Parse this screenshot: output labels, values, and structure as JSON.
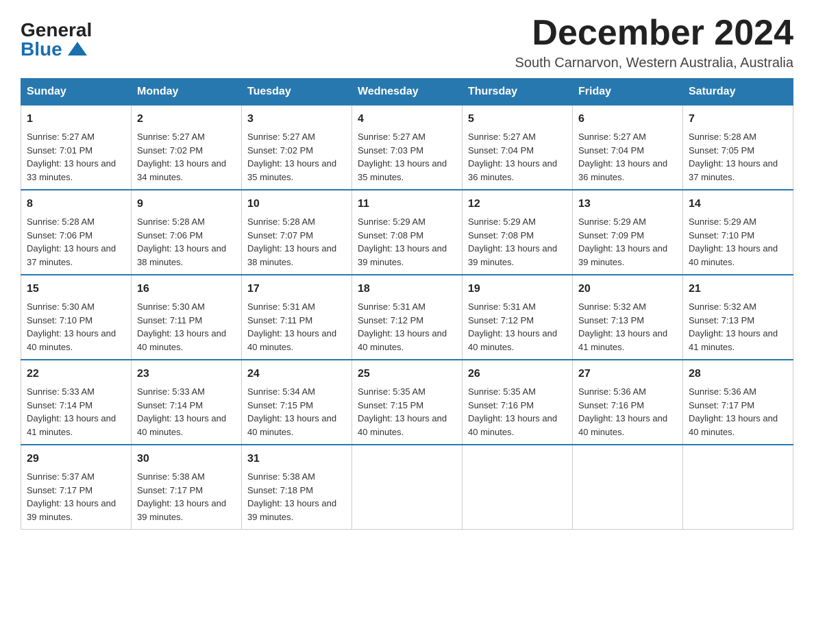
{
  "header": {
    "logo_general": "General",
    "logo_blue": "Blue",
    "month_title": "December 2024",
    "subtitle": "South Carnarvon, Western Australia, Australia"
  },
  "days_of_week": [
    "Sunday",
    "Monday",
    "Tuesday",
    "Wednesday",
    "Thursday",
    "Friday",
    "Saturday"
  ],
  "weeks": [
    [
      {
        "day": "1",
        "sunrise": "5:27 AM",
        "sunset": "7:01 PM",
        "daylight": "13 hours and 33 minutes."
      },
      {
        "day": "2",
        "sunrise": "5:27 AM",
        "sunset": "7:02 PM",
        "daylight": "13 hours and 34 minutes."
      },
      {
        "day": "3",
        "sunrise": "5:27 AM",
        "sunset": "7:02 PM",
        "daylight": "13 hours and 35 minutes."
      },
      {
        "day": "4",
        "sunrise": "5:27 AM",
        "sunset": "7:03 PM",
        "daylight": "13 hours and 35 minutes."
      },
      {
        "day": "5",
        "sunrise": "5:27 AM",
        "sunset": "7:04 PM",
        "daylight": "13 hours and 36 minutes."
      },
      {
        "day": "6",
        "sunrise": "5:27 AM",
        "sunset": "7:04 PM",
        "daylight": "13 hours and 36 minutes."
      },
      {
        "day": "7",
        "sunrise": "5:28 AM",
        "sunset": "7:05 PM",
        "daylight": "13 hours and 37 minutes."
      }
    ],
    [
      {
        "day": "8",
        "sunrise": "5:28 AM",
        "sunset": "7:06 PM",
        "daylight": "13 hours and 37 minutes."
      },
      {
        "day": "9",
        "sunrise": "5:28 AM",
        "sunset": "7:06 PM",
        "daylight": "13 hours and 38 minutes."
      },
      {
        "day": "10",
        "sunrise": "5:28 AM",
        "sunset": "7:07 PM",
        "daylight": "13 hours and 38 minutes."
      },
      {
        "day": "11",
        "sunrise": "5:29 AM",
        "sunset": "7:08 PM",
        "daylight": "13 hours and 39 minutes."
      },
      {
        "day": "12",
        "sunrise": "5:29 AM",
        "sunset": "7:08 PM",
        "daylight": "13 hours and 39 minutes."
      },
      {
        "day": "13",
        "sunrise": "5:29 AM",
        "sunset": "7:09 PM",
        "daylight": "13 hours and 39 minutes."
      },
      {
        "day": "14",
        "sunrise": "5:29 AM",
        "sunset": "7:10 PM",
        "daylight": "13 hours and 40 minutes."
      }
    ],
    [
      {
        "day": "15",
        "sunrise": "5:30 AM",
        "sunset": "7:10 PM",
        "daylight": "13 hours and 40 minutes."
      },
      {
        "day": "16",
        "sunrise": "5:30 AM",
        "sunset": "7:11 PM",
        "daylight": "13 hours and 40 minutes."
      },
      {
        "day": "17",
        "sunrise": "5:31 AM",
        "sunset": "7:11 PM",
        "daylight": "13 hours and 40 minutes."
      },
      {
        "day": "18",
        "sunrise": "5:31 AM",
        "sunset": "7:12 PM",
        "daylight": "13 hours and 40 minutes."
      },
      {
        "day": "19",
        "sunrise": "5:31 AM",
        "sunset": "7:12 PM",
        "daylight": "13 hours and 40 minutes."
      },
      {
        "day": "20",
        "sunrise": "5:32 AM",
        "sunset": "7:13 PM",
        "daylight": "13 hours and 41 minutes."
      },
      {
        "day": "21",
        "sunrise": "5:32 AM",
        "sunset": "7:13 PM",
        "daylight": "13 hours and 41 minutes."
      }
    ],
    [
      {
        "day": "22",
        "sunrise": "5:33 AM",
        "sunset": "7:14 PM",
        "daylight": "13 hours and 41 minutes."
      },
      {
        "day": "23",
        "sunrise": "5:33 AM",
        "sunset": "7:14 PM",
        "daylight": "13 hours and 40 minutes."
      },
      {
        "day": "24",
        "sunrise": "5:34 AM",
        "sunset": "7:15 PM",
        "daylight": "13 hours and 40 minutes."
      },
      {
        "day": "25",
        "sunrise": "5:35 AM",
        "sunset": "7:15 PM",
        "daylight": "13 hours and 40 minutes."
      },
      {
        "day": "26",
        "sunrise": "5:35 AM",
        "sunset": "7:16 PM",
        "daylight": "13 hours and 40 minutes."
      },
      {
        "day": "27",
        "sunrise": "5:36 AM",
        "sunset": "7:16 PM",
        "daylight": "13 hours and 40 minutes."
      },
      {
        "day": "28",
        "sunrise": "5:36 AM",
        "sunset": "7:17 PM",
        "daylight": "13 hours and 40 minutes."
      }
    ],
    [
      {
        "day": "29",
        "sunrise": "5:37 AM",
        "sunset": "7:17 PM",
        "daylight": "13 hours and 39 minutes."
      },
      {
        "day": "30",
        "sunrise": "5:38 AM",
        "sunset": "7:17 PM",
        "daylight": "13 hours and 39 minutes."
      },
      {
        "day": "31",
        "sunrise": "5:38 AM",
        "sunset": "7:18 PM",
        "daylight": "13 hours and 39 minutes."
      },
      null,
      null,
      null,
      null
    ]
  ]
}
